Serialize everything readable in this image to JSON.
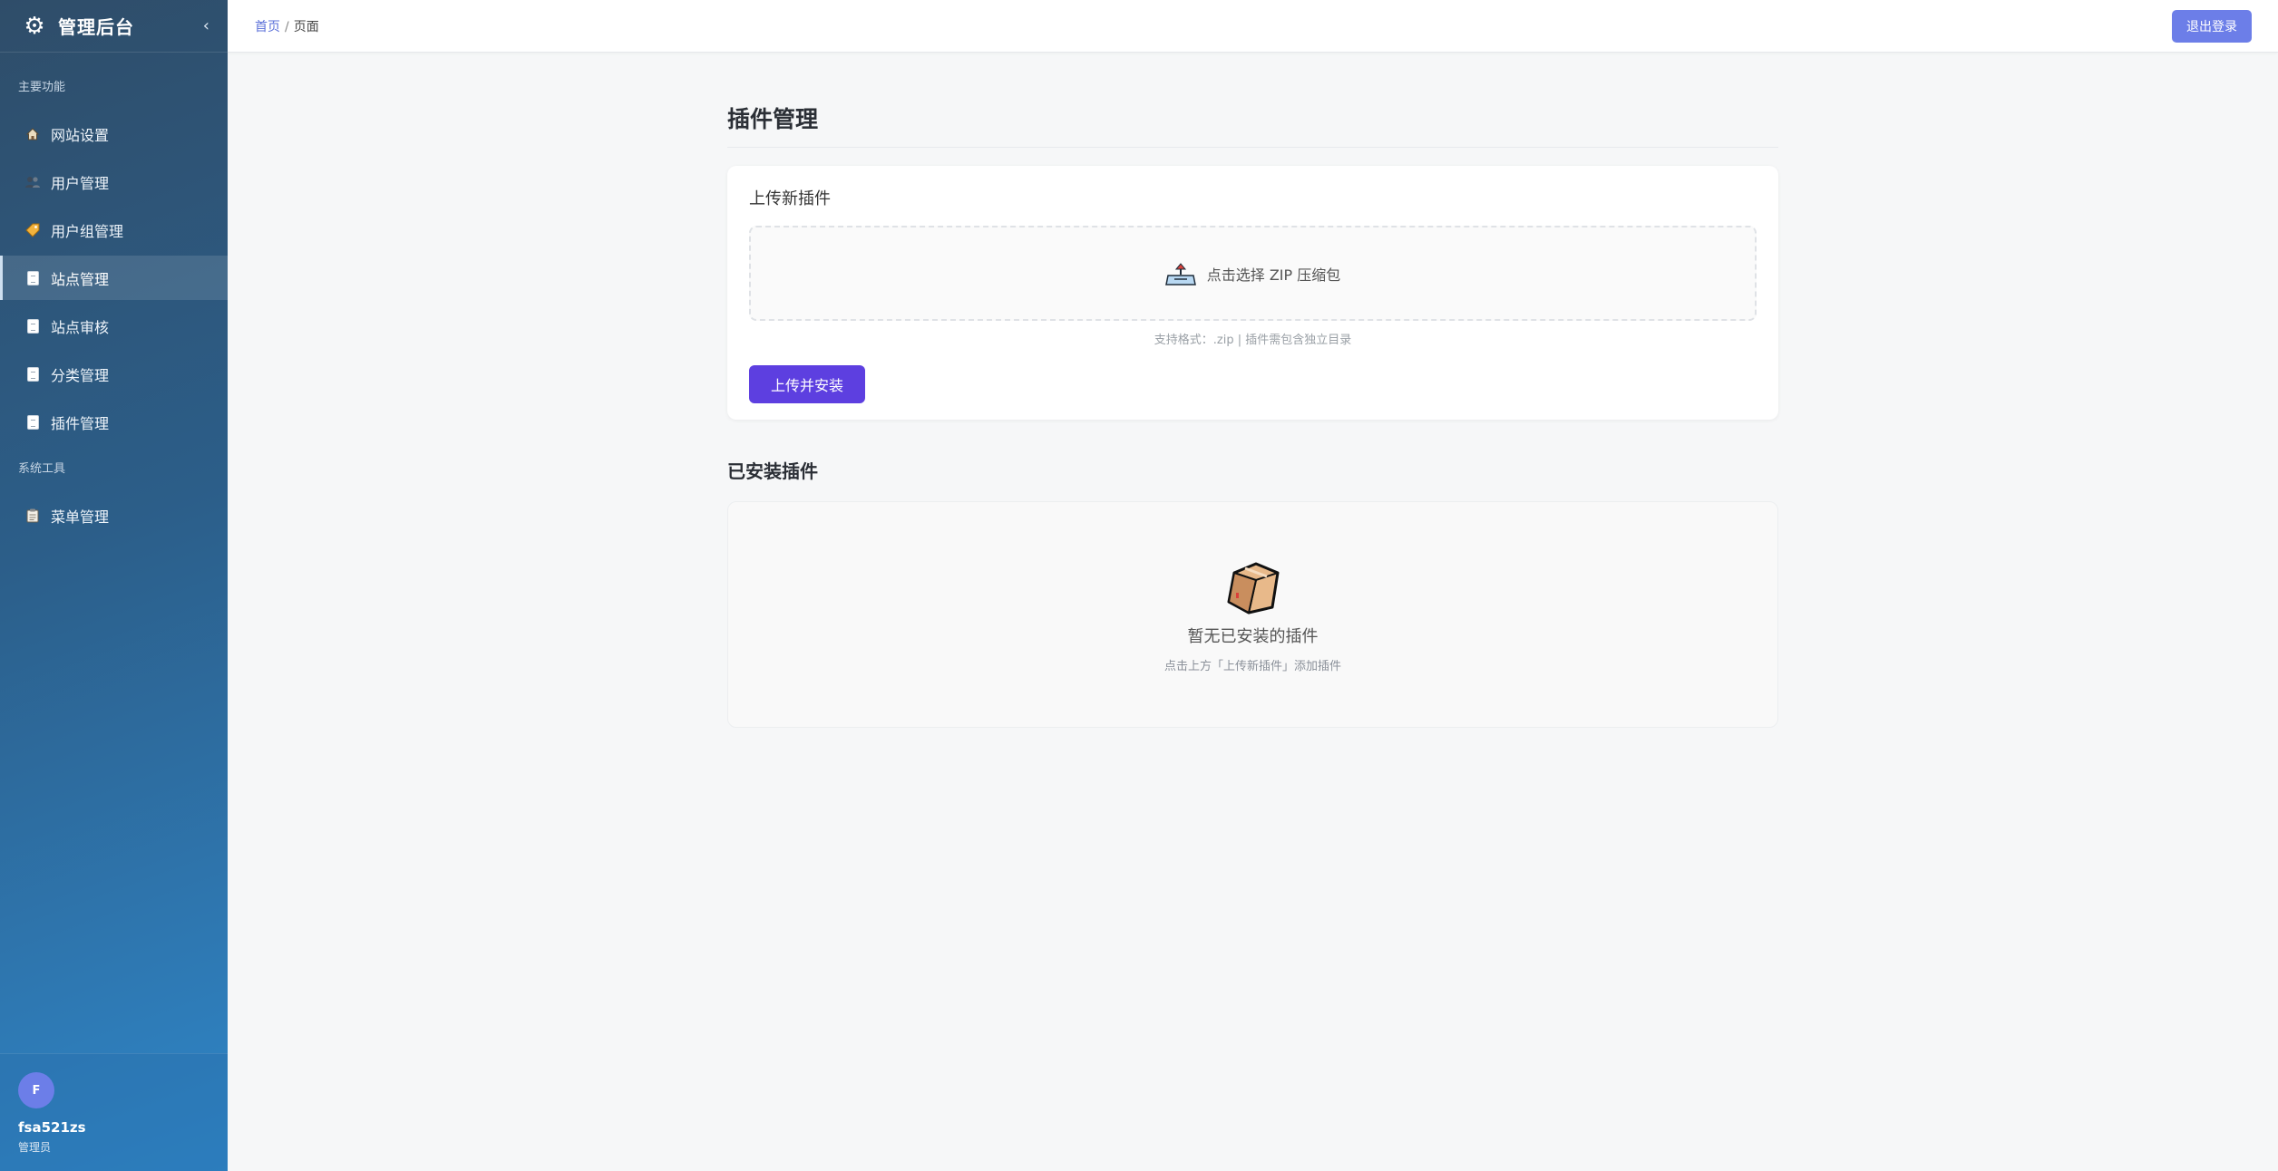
{
  "sidebar": {
    "title": "管理后台",
    "logo_icon": "gear-icon",
    "collapse_glyph": "‹",
    "section_main": "主要功能",
    "section_tools": "系统工具",
    "items": [
      {
        "label": "网站设置",
        "icon": "house-icon"
      },
      {
        "label": "用户管理",
        "icon": "users-icon"
      },
      {
        "label": "用户组管理",
        "icon": "tag-icon"
      },
      {
        "label": "站点管理",
        "icon": "page-icon",
        "active": true
      },
      {
        "label": "站点审核",
        "icon": "page-icon"
      },
      {
        "label": "分类管理",
        "icon": "page-icon"
      },
      {
        "label": "插件管理",
        "icon": "page-icon"
      }
    ],
    "tool_items": [
      {
        "label": "菜单管理",
        "icon": "clipboard-icon"
      }
    ],
    "user": {
      "avatar_letter": "F",
      "name": "fsa521zs",
      "role": "管理员"
    }
  },
  "topbar": {
    "breadcrumb_home": "首页",
    "breadcrumb_sep": "/",
    "breadcrumb_current": "页面",
    "logout_label": "退出登录"
  },
  "main": {
    "page_title": "插件管理",
    "upload": {
      "title": "上传新插件",
      "dropzone_label": "点击选择 ZIP 压缩包",
      "hint": "支持格式：.zip | 插件需包含独立目录",
      "button_label": "上传并安装"
    },
    "installed": {
      "title": "已安装插件",
      "empty_title": "暂无已安装的插件",
      "empty_sub": "点击上方「上传新插件」添加插件"
    }
  },
  "colors": {
    "accent": "#6c7ee8",
    "primary_button": "#5d3fe0",
    "sidebar_top": "#2f4d69",
    "sidebar_bottom": "#2f86c8"
  }
}
